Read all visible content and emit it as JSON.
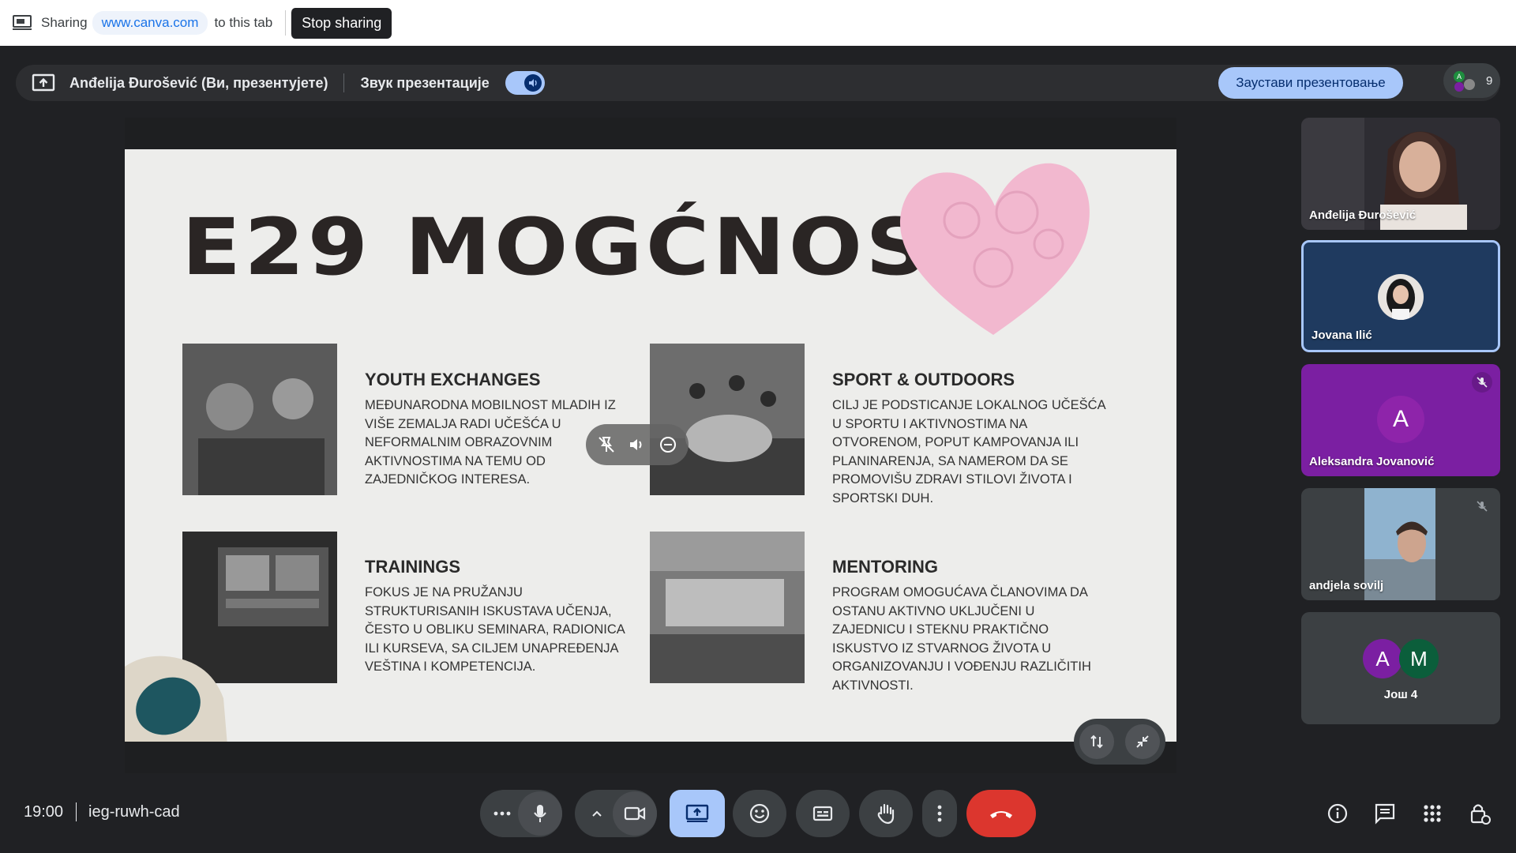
{
  "sharebar": {
    "sharing_label": "Sharing",
    "domain": "www.canva.com",
    "to_label": "to this tab",
    "stop_label": "Stop sharing"
  },
  "presbar": {
    "presenter": "Anđelija Đurošević (Ви, презентујете)",
    "audio_label": "Звук презентације",
    "stop_present": "Заустави презентовање",
    "participant_count": "9"
  },
  "slide": {
    "title": "E29 MOGĆNOSTi",
    "sections": [
      {
        "title": "YOUTH EXCHANGES",
        "body": "MEĐUNARODNA MOBILNOST MLADIH IZ VIŠE ZEMALJA RADI UČEŠĆA U NEFORMALNIM OBRAZOVNIM AKTIVNOSTIMA NA TEMU OD ZAJEDNIČKOG INTERESA."
      },
      {
        "title": "SPORT & OUTDOORS",
        "body": "CILJ JE PODSTICANJE LOKALNOG UČEŠĆA U SPORTU I AKTIVNOSTIMA NA OTVORENOM, POPUT KAMPOVANJA ILI PLANINARENJA, SA NAMEROM DA SE PROMOVIŠU ZDRAVI STILOVI ŽIVOTA I SPORTSKI DUH."
      },
      {
        "title": "TRAININGS",
        "body": "FOKUS JE NA PRUŽANJU STRUKTURISANIH ISKUSTAVA UČENJA, ČESTO U OBLIKU SEMINARA, RADIONICA ILI KURSEVA, SA CILJEM UNAPREĐENJA VEŠTINA I KOMPETENCIJA."
      },
      {
        "title": "MENTORING",
        "body": "PROGRAM OMOGUĆAVA ČLANOVIMA DA OSTANU AKTIVNO UKLJUČENI U ZAJEDNICU I STEKNU PRAKTIČNO ISKUSTVO IZ STVARNOG ŽIVOTA U ORGANIZOVANJU I VOĐENJU RAZLIČITIH AKTIVNOSTI."
      }
    ]
  },
  "tiles": [
    {
      "name": "Anđelija Đurošević"
    },
    {
      "name": "Jovana Ilić"
    },
    {
      "name": "Aleksandra Jovanović",
      "initial": "A"
    },
    {
      "name": "andjela sovilj"
    },
    {
      "more_label": "Још 4",
      "initials": [
        "A",
        "M"
      ]
    }
  ],
  "colors": {
    "active_speaker_border": "#a8c7fa",
    "aleksandra_tile": "#7b1fa2",
    "hangup": "#dc362e",
    "accent": "#a8c7fa"
  },
  "bottombar": {
    "time": "19:00",
    "meeting_code": "ieg-ruwh-cad"
  },
  "icons": [
    "screen-share-icon",
    "present-icon",
    "mic-icon",
    "camera-icon",
    "emoji-icon",
    "captions-icon",
    "raise-hand-icon",
    "more-vert-icon",
    "hangup-icon",
    "info-icon",
    "chat-icon",
    "activities-icon",
    "host-controls-icon"
  ]
}
